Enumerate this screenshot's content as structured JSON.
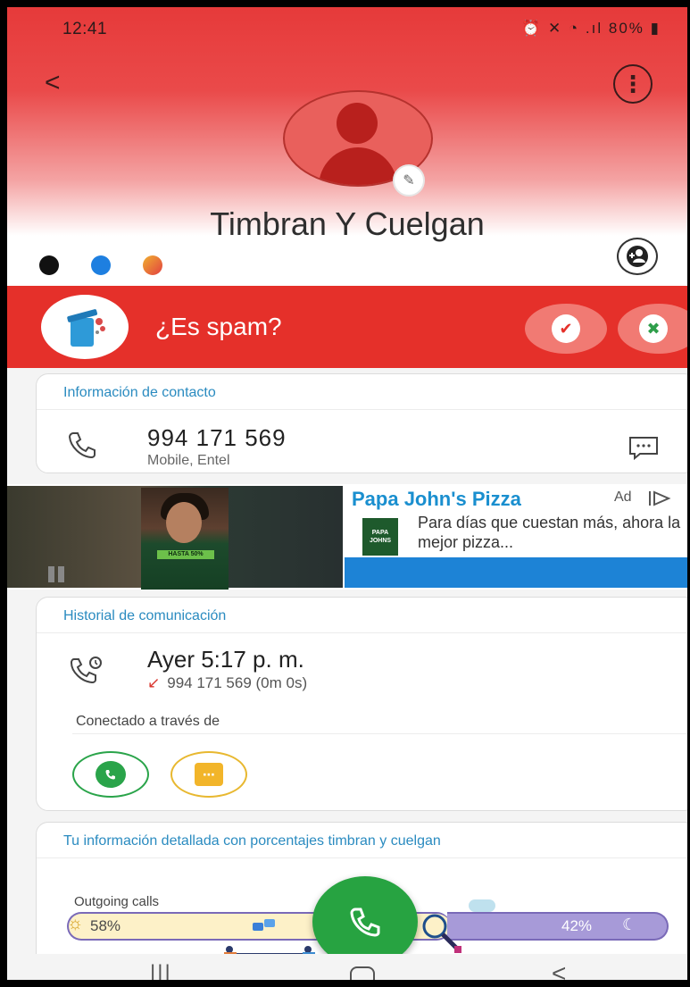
{
  "status_bar": {
    "time": "12:41",
    "icons": "⏰ ✕ ◔ .ıl",
    "battery": "80%"
  },
  "header": {
    "contact_name": "Timbran Y Cuelgan",
    "colors": [
      "#111111",
      "#1e7fe0",
      "#f0b030"
    ]
  },
  "spam_banner": {
    "question": "¿Es spam?",
    "yes_icon": "✔",
    "no_icon": "✖"
  },
  "contact_info": {
    "title": "Información de contacto",
    "phone_number": "994 171 569",
    "phone_sub": "Mobile, Entel"
  },
  "ad": {
    "brand": "Papa John's Pizza",
    "label": "Ad",
    "text": "Para días que cuestan más, ahora la mejor pizza...",
    "logo_line1": "PAPA",
    "logo_line2": "JOHNS",
    "video_label": "HASTA 50%"
  },
  "history": {
    "title": "Historial de comunicación",
    "call_time": "Ayer 5:17 p. m.",
    "call_detail": "994 171 569 (0m 0s)",
    "connected_label": "Conectado a través de"
  },
  "stats": {
    "title": "Tu información detallada con porcentajes timbran y cuelgan",
    "outgoing_label": "Outgoing calls",
    "day_pct": "58%",
    "night_pct": "42%",
    "day_fraction": 0.58
  },
  "accent": {
    "brand_red": "#e5302a",
    "call_green": "#27a341",
    "link_blue": "#2a8bc0"
  }
}
